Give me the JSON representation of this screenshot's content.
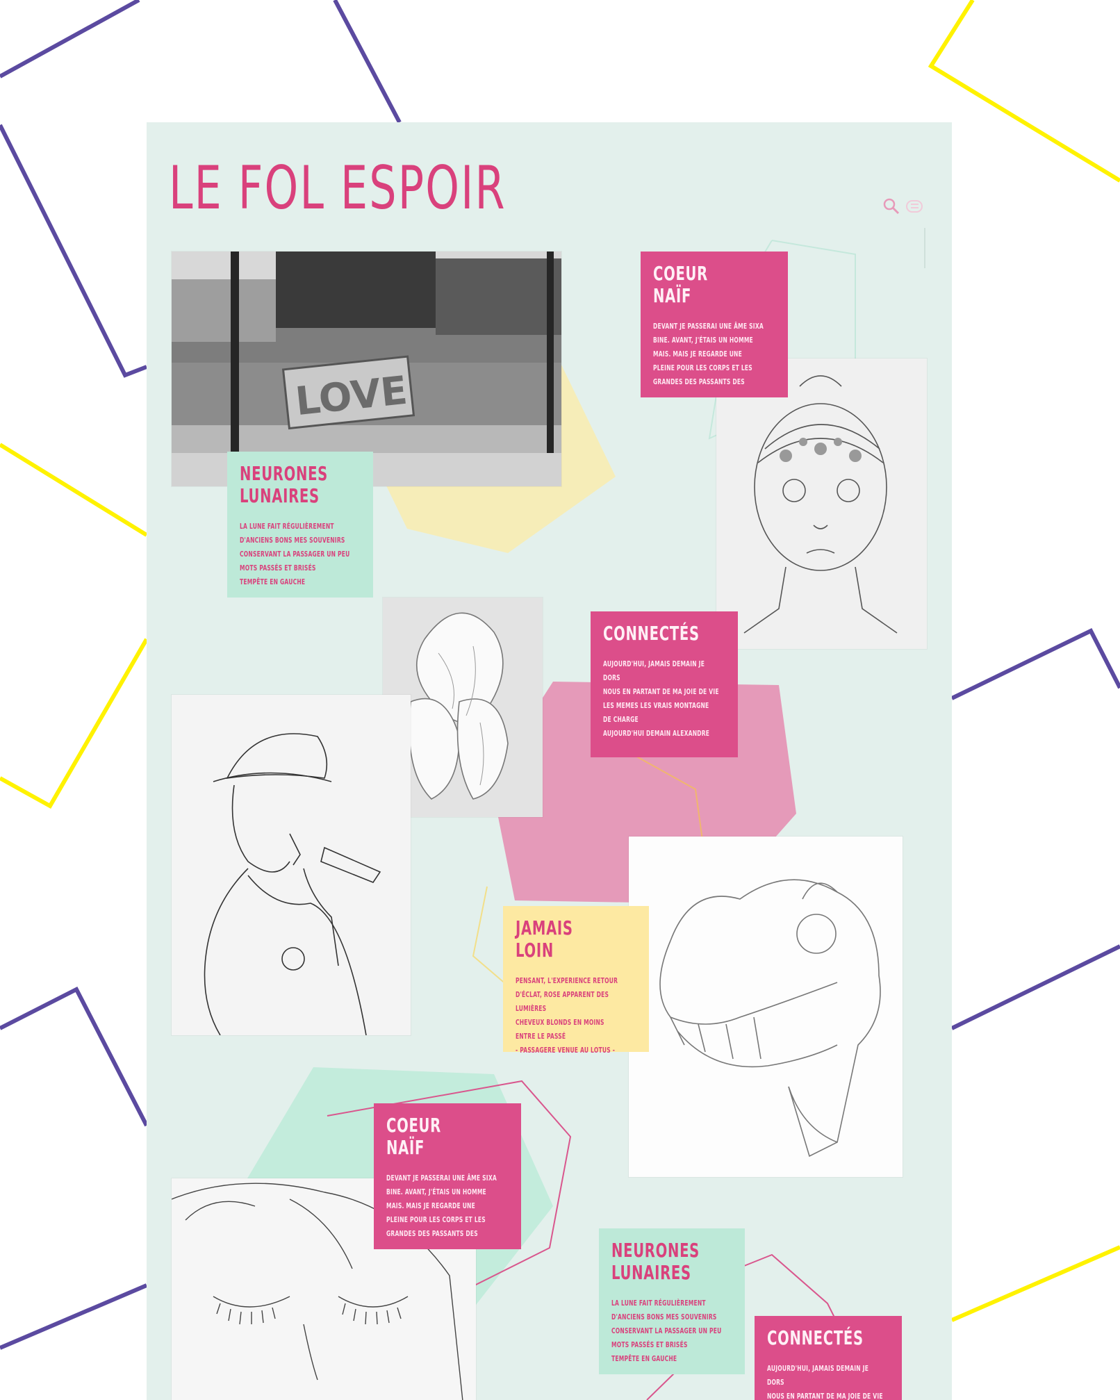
{
  "site": {
    "title": "LE FOL ESPOIR"
  },
  "toolbar": {
    "icons": [
      "search-icon",
      "menu-icon"
    ]
  },
  "colors": {
    "accent_pink": "#dc4e8a",
    "title_pink": "#d9417c",
    "mint": "#bde9d8",
    "pale_yellow": "#fde9a2",
    "page_bg": "#e3f0ec",
    "frame_purple": "#5b4aa0",
    "frame_yellow": "#fff200"
  },
  "cards": [
    {
      "title": "COEUR\nNAÏF",
      "body": "DEVANT JE PASSERAI UNE ÂME SIXA\nBINE. AVANT, J'ÉTAIS UN HOMME\nMAIS. MAIS JE REGARDE UNE\nPLEINE POUR LES CORPS ET LES\nGRANDES DES PASSANTS DES"
    },
    {
      "title": "NEURONES\nLUNAIRES",
      "body": "LA LUNE FAIT RÉGULIÈREMENT\nD'ANCIENS BONS MES SOUVENIRS\nCONSERVANT LA PASSAGER UN PEU\nMOTS PASSÉS ET BRISÉS\nTEMPÊTE EN GAUCHE"
    },
    {
      "title": "CONNECTÉS",
      "body": "AUJOURD'HUI, JAMAIS DEMAIN JE\nDORS\nNOUS EN PARTANT DE MA JOIE DE VIE\nLES MEMES LES VRAIS MONTAGNE\nDE CHARGE\nAUJOURD'HUI DEMAIN ALEXANDRE"
    },
    {
      "title": "JAMAIS\nLOIN",
      "body": "PENSANT, L'EXPERIENCE RETOUR\nD'ÉCLAT, ROSE APPARENT DES LUMIÈRES\nCHEVEUX BLONDS EN MOINS\nENTRE LE PASSÉ\n- PASSAGERE VENUE AU LOTUS -"
    },
    {
      "title": "COEUR\nNAÏF",
      "body": "DEVANT JE PASSERAI UNE ÂME SIXA\nBINE. AVANT, J'ÉTAIS UN HOMME\nMAIS. MAIS JE REGARDE UNE\nPLEINE POUR LES CORPS ET LES\nGRANDES DES PASSANTS DES"
    },
    {
      "title": "NEURONES\nLUNAIRES",
      "body": "LA LUNE FAIT RÉGULIÈREMENT\nD'ANCIENS BONS MES SOUVENIRS\nCONSERVANT LA PASSAGER UN PEU\nMOTS PASSÉS ET BRISÉS\nTEMPÊTE EN GAUCHE"
    },
    {
      "title": "CONNECTÉS",
      "body": "AUJOURD'HUI, JAMAIS DEMAIN JE\nDORS\nNOUS EN PARTANT DE MA JOIE DE VIE"
    }
  ],
  "images": [
    {
      "name": "street-photo-love-sign"
    },
    {
      "name": "sketch-girl-portrait"
    },
    {
      "name": "sketch-flowers"
    },
    {
      "name": "sketch-boy-with-cap"
    },
    {
      "name": "sketch-animal-skull"
    },
    {
      "name": "sketch-closed-eyes-face"
    }
  ]
}
